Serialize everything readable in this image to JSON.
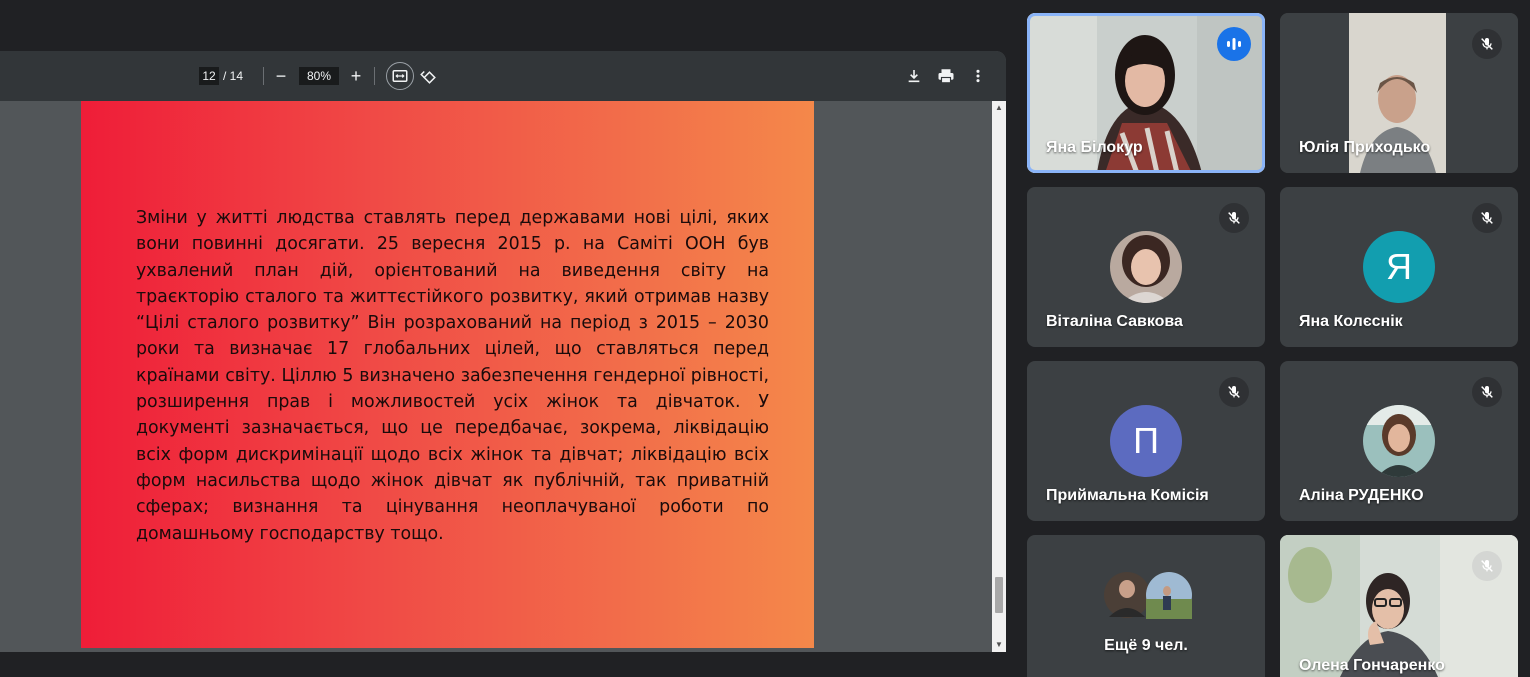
{
  "pdf_viewer": {
    "page_current": "12",
    "page_total": "/ 14",
    "zoom": "80%",
    "zoom_out_glyph": "−",
    "zoom_in_glyph": "+",
    "icons": [
      "fit-to-page-icon",
      "rotate-icon",
      "download-icon",
      "print-icon",
      "more-vert-icon"
    ],
    "page_text": "Зміни у житті людства ставлять перед державами нові цілі, яких вони повинні досягати. 25 вересня 2015 р. на Саміті ООН був ухвалений план дій, орієнтований на виведення світу на траєкторію сталого та життєстійкого розвитку, який отримав назву “Цілі сталого розвитку” Він розрахований на період з 2015 – 2030 роки та визначає 17 глобальних цілей, що ставляться перед країнами світу. Ціллю 5 визначено забезпечення гендерної рівності, розширення прав і можливостей усіх жінок та дівчаток. У документі зазначається, що це передбачає, зокрема, ліквідацію всіх форм дискримінації щодо всіх жінок та дівчат; ліквідацію всіх форм насильства щодо жінок дівчат як публічній, так приватній сферах; визнання та цінування неоплачуваної роботи по домашньому господарству тощо.",
    "page_gradient": [
      "#ef1d38",
      "#f4884a"
    ]
  },
  "participants": [
    {
      "name": "Яна Білокур",
      "type": "video",
      "speaking": true
    },
    {
      "name": "Юлія Приходько",
      "type": "video",
      "muted": true
    },
    {
      "name": "Віталіна Савкова",
      "type": "photo",
      "muted": true
    },
    {
      "name": "Яна Колєснік",
      "type": "letter",
      "letter": "Я",
      "color": "#129eaf",
      "muted": true
    },
    {
      "name": "Приймальна Комісія",
      "type": "letter",
      "letter": "П",
      "color": "#5c6bc0",
      "muted": true
    },
    {
      "name": "Аліна РУДЕНКО",
      "type": "photo",
      "muted": true
    },
    {
      "name": "Ещё 9 чел.",
      "type": "more"
    },
    {
      "name": "Олена Гончаренко",
      "type": "video",
      "muted": true
    }
  ],
  "colors": {
    "background": "#202124",
    "tile": "#3c4043",
    "active_border": "#8ab4f8",
    "speaking_badge": "#1a73e8"
  }
}
